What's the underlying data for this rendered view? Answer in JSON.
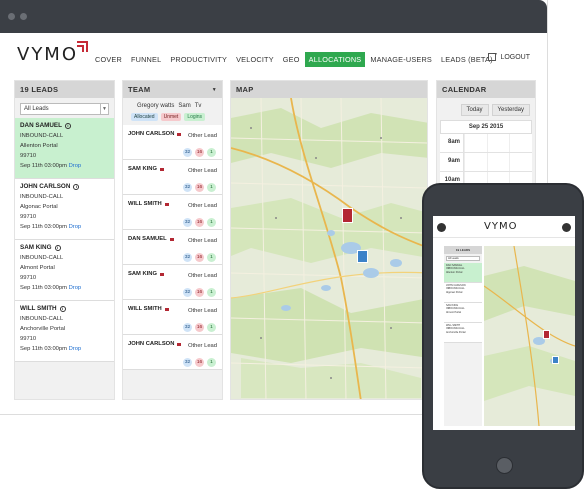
{
  "app": {
    "logo": "VYMO",
    "nav": [
      "COVER",
      "FUNNEL",
      "PRODUCTIVITY",
      "VELOCITY",
      "GEO",
      "ALLOCATIONS",
      "MANAGE-USERS",
      "LEADS (BETA)"
    ],
    "active_nav": "ALLOCATIONS",
    "logout": "LOGOUT"
  },
  "leads": {
    "title": "19 LEADS",
    "filter": "All Leads",
    "items": [
      {
        "name": "DAN SAMUEL",
        "type": "INBOUND-CALL",
        "location": "Allenton Portal",
        "zip": "99710",
        "time": "Sep 11th 03:00pm",
        "action": "Drop"
      },
      {
        "name": "JOHN CARLSON",
        "type": "INBOUND-CALL",
        "location": "Algonac Portal",
        "zip": "99710",
        "time": "Sep 11th 03:00pm",
        "action": "Drop"
      },
      {
        "name": "SAM KING",
        "type": "INBOUND-CALL",
        "location": "Almont Portal",
        "zip": "99710",
        "time": "Sep 11th 03:00pm",
        "action": "Drop"
      },
      {
        "name": "WILL SMITH",
        "type": "INBOUND-CALL",
        "location": "Anchorville Portal",
        "zip": "99710",
        "time": "Sep 11th 03:00pm",
        "action": "Drop"
      }
    ]
  },
  "team": {
    "title": "TEAM",
    "users": [
      "Gregory watts",
      "Sam",
      "Tv"
    ],
    "tags": [
      "Allocated",
      "Unmet",
      "Logins"
    ],
    "members": [
      {
        "name": "JOHN CARLSON",
        "status": "Other Lead",
        "allocated": "32",
        "unmet": "16",
        "logins": "1"
      },
      {
        "name": "SAM KING",
        "status": "Other Lead",
        "allocated": "32",
        "unmet": "16",
        "logins": "1"
      },
      {
        "name": "WILL SMITH",
        "status": "Other Lead",
        "allocated": "32",
        "unmet": "16",
        "logins": "1"
      },
      {
        "name": "DAN SAMUEL",
        "status": "Other Lead",
        "allocated": "32",
        "unmet": "16",
        "logins": "1"
      },
      {
        "name": "SAM KING",
        "status": "Other Lead",
        "allocated": "32",
        "unmet": "16",
        "logins": "1"
      },
      {
        "name": "WILL SMITH",
        "status": "Other Lead",
        "allocated": "32",
        "unmet": "16",
        "logins": "1"
      },
      {
        "name": "JOHN CARLSON",
        "status": "Other Lead",
        "allocated": "32",
        "unmet": "16",
        "logins": "1"
      }
    ]
  },
  "map": {
    "title": "MAP"
  },
  "calendar": {
    "title": "CALENDAR",
    "today": "Today",
    "yesterday": "Yesterday",
    "date": "Sep 25 2015",
    "slots": [
      "8am",
      "9am",
      "10am"
    ]
  },
  "phone": {
    "logo": "VYMO",
    "leads_title": "19 LEADS"
  },
  "colors": {
    "accent_green": "#2fa84f",
    "brand_red": "#c62a36",
    "chrome_dark": "#3b3f45"
  }
}
